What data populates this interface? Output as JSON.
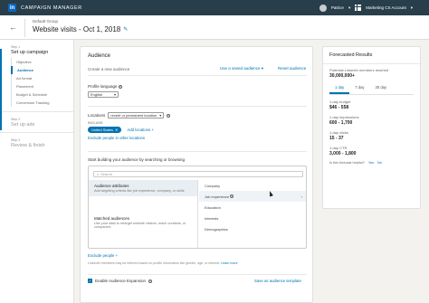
{
  "topbar": {
    "logo": "in",
    "app_name": "CAMPAIGN MANAGER",
    "user": "Patrice",
    "account": "Marketing CS Account"
  },
  "header": {
    "back_icon": "back-arrow-icon",
    "group": "Default Group",
    "title": "Website visits - Oct 1, 2018"
  },
  "sidebar": {
    "steps": [
      {
        "label": "Step 1",
        "name": "Set up campaign",
        "substeps": [
          "Objective",
          "Audience",
          "Ad format",
          "Placement",
          "Budget & Schedule",
          "Conversion Tracking"
        ],
        "active_index": 1
      },
      {
        "label": "Step 2",
        "name": "Set up ads"
      },
      {
        "label": "Step 3",
        "name": "Review & finish"
      }
    ]
  },
  "audience": {
    "title": "Audience",
    "subtitle": "Create a new audience",
    "saved_link": "Use a saved audience",
    "reset_link": "Reset audience",
    "profile_language_label": "Profile language",
    "language_value": "English",
    "locations_label": "Locations",
    "locations_mode": "recent or permanent location",
    "include_label": "INCLUDE",
    "chip": "United States",
    "add_locations": "Add locations",
    "exclude_link": "Exclude people in other locations",
    "builder_label": "Start building your audience by searching or browsing",
    "search_placeholder": "Search",
    "categories": [
      {
        "title": "Audience attributes",
        "desc": "Add targeting criteria like job experience, company, or skills"
      },
      {
        "title": "Matched audiences",
        "desc": "Use your data to retarget website visitors, reach contacts, or companies"
      }
    ],
    "attributes": [
      "Company",
      "Job experience",
      "Education",
      "Interests",
      "Demographics"
    ],
    "exclude_people": "Exclude people",
    "disclaimer": "LinkedIn members may be inferred based on profile information like gender, age, or interest.",
    "learn_more": "Learn more",
    "expansion_label": "Enable Audience Expansion",
    "save_template": "Save as audience template"
  },
  "forecast": {
    "title": "Forecasted Results",
    "potential_label": "Potential LinkedIn members reached",
    "potential_value": "30,000,000+",
    "tabs": [
      "1 day",
      "7 day",
      "30 day"
    ],
    "active_tab": 0,
    "metrics": [
      {
        "label": "1-day budget",
        "value": "$46 - 558"
      },
      {
        "label": "1-day impressions",
        "value": "600 - 1,700"
      },
      {
        "label": "1-day clicks",
        "value": "15 - 37"
      },
      {
        "label": "1-day CTR",
        "value": "3,000 - 1,800"
      }
    ],
    "feedback_q": "Is this forecast helpful?",
    "yes": "Yes",
    "no": "No"
  }
}
